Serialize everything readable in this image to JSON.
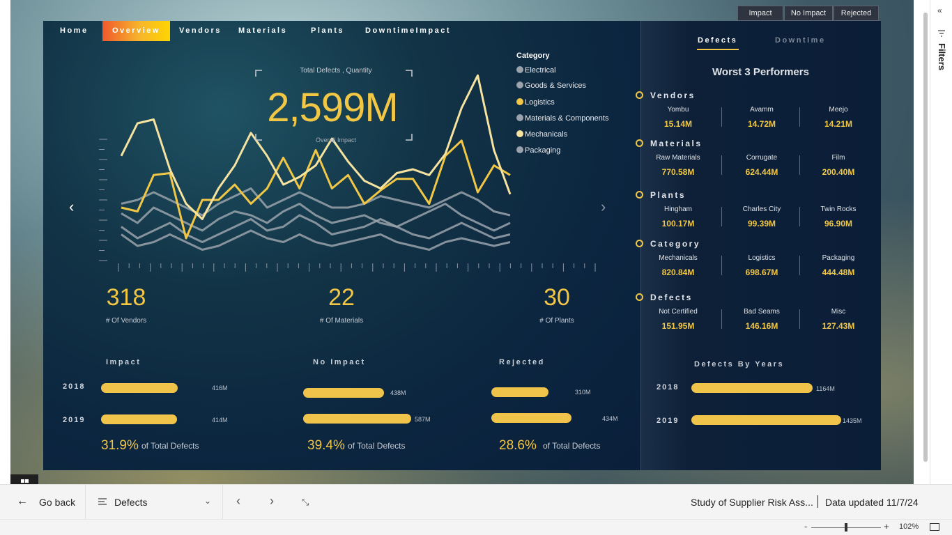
{
  "filter_chips": [
    "Impact",
    "No Impact",
    "Rejected"
  ],
  "nav": {
    "items": [
      "Home",
      "Overview",
      "Vendors",
      "Materials",
      "Plants",
      "DowntimeImpact"
    ],
    "active": "Overview"
  },
  "headline": {
    "caption": "Total Defects , Quantity",
    "value": "2,599M",
    "sub": "Overall Impact"
  },
  "legend": {
    "title": "Category",
    "items": [
      {
        "label": "Electrical",
        "color": "#9aa3ab"
      },
      {
        "label": "Goods & Services",
        "color": "#9aa3ab"
      },
      {
        "label": "Logistics",
        "color": "#f1c745"
      },
      {
        "label": "Materials & Components",
        "color": "#9aa3ab"
      },
      {
        "label": "Mechanicals",
        "color": "#f6e3a0"
      },
      {
        "label": "Packaging",
        "color": "#9aa3ab"
      }
    ]
  },
  "kpis": [
    {
      "value": "318",
      "label": "# Of Vendors"
    },
    {
      "value": "22",
      "label": "# Of Materials"
    },
    {
      "value": "30",
      "label": "# Of Plants"
    }
  ],
  "impact_sections": [
    {
      "title": "Impact",
      "bars": [
        {
          "year": "2018",
          "label": "416M",
          "value": 416
        },
        {
          "year": "2019",
          "label": "414M",
          "value": 414
        }
      ],
      "pct": "31.9%",
      "pct_label": "of Total Defects"
    },
    {
      "title": "No Impact",
      "bars": [
        {
          "year": "2018",
          "label": "438M",
          "value": 438
        },
        {
          "year": "2019",
          "label": "587M",
          "value": 587
        }
      ],
      "pct": "39.4%",
      "pct_label": "of Total Defects"
    },
    {
      "title": "Rejected",
      "bars": [
        {
          "year": "2018",
          "label": "310M",
          "value": 310
        },
        {
          "year": "2019",
          "label": "434M",
          "value": 434
        }
      ],
      "pct": "28.6%",
      "pct_label": "of Total Defects"
    }
  ],
  "right_panel": {
    "tabs": [
      "Defects",
      "Downtime"
    ],
    "active_tab": "Defects",
    "title": "Worst 3 Performers",
    "groups": [
      {
        "heading": "Vendors",
        "items": [
          {
            "name": "Yombu",
            "value": "15.14M"
          },
          {
            "name": "Avamm",
            "value": "14.72M"
          },
          {
            "name": "Meejo",
            "value": "14.21M"
          }
        ]
      },
      {
        "heading": "Materials",
        "items": [
          {
            "name": "Raw Materials",
            "value": "770.58M"
          },
          {
            "name": "Corrugate",
            "value": "624.44M"
          },
          {
            "name": "Film",
            "value": "200.40M"
          }
        ]
      },
      {
        "heading": "Plants",
        "items": [
          {
            "name": "Hingham",
            "value": "100.17M"
          },
          {
            "name": "Charles City",
            "value": "99.39M"
          },
          {
            "name": "Twin Rocks",
            "value": "96.90M"
          }
        ]
      },
      {
        "heading": "Category",
        "items": [
          {
            "name": "Mechanicals",
            "value": "820.84M"
          },
          {
            "name": "Logistics",
            "value": "698.67M"
          },
          {
            "name": "Packaging",
            "value": "444.48M"
          }
        ]
      },
      {
        "heading": "Defects",
        "items": [
          {
            "name": "Not Certified",
            "value": "151.95M"
          },
          {
            "name": "Bad Seams",
            "value": "146.16M"
          },
          {
            "name": "Misc",
            "value": "127.43M"
          }
        ]
      }
    ],
    "years_title": "Defects By Years",
    "years": [
      {
        "year": "2018",
        "label": "1164M",
        "value": 1164
      },
      {
        "year": "2019",
        "label": "1435M",
        "value": 1435
      }
    ]
  },
  "trend_chart": {
    "series": [
      {
        "color": "#f6e3a0",
        "values": [
          55,
          72,
          74,
          48,
          30,
          22,
          38,
          50,
          67,
          55,
          40,
          44,
          50,
          64,
          52,
          42,
          38,
          46,
          48,
          45,
          56,
          80,
          97,
          58,
          35
        ]
      },
      {
        "color": "#f1c745",
        "values": [
          28,
          26,
          45,
          46,
          12,
          32,
          32,
          40,
          30,
          38,
          54,
          38,
          58,
          38,
          45,
          30,
          37,
          43,
          43,
          30,
          55,
          63,
          36,
          50,
          45
        ]
      },
      {
        "color": "#9aa3ab",
        "values": [
          30,
          32,
          36,
          32,
          28,
          24,
          30,
          34,
          38,
          28,
          32,
          36,
          32,
          28,
          28,
          30,
          34,
          32,
          30,
          28,
          32,
          36,
          32,
          26,
          24
        ]
      },
      {
        "color": "#9aa3ab",
        "values": [
          25,
          20,
          28,
          24,
          20,
          16,
          22,
          26,
          24,
          20,
          26,
          30,
          24,
          20,
          22,
          24,
          20,
          18,
          22,
          26,
          30,
          24,
          20,
          16,
          20
        ]
      },
      {
        "color": "#9aa3ab",
        "values": [
          18,
          12,
          16,
          20,
          14,
          10,
          14,
          18,
          22,
          16,
          18,
          24,
          20,
          14,
          16,
          18,
          22,
          18,
          14,
          12,
          16,
          20,
          16,
          12,
          14
        ]
      },
      {
        "color": "#9aa3ab",
        "values": [
          14,
          8,
          10,
          14,
          10,
          6,
          8,
          12,
          16,
          12,
          10,
          14,
          10,
          8,
          10,
          12,
          14,
          10,
          8,
          6,
          10,
          12,
          10,
          8,
          10
        ]
      }
    ]
  },
  "bottom_bar": {
    "back_label": "Go back",
    "page_label": "Defects",
    "report_title": "Study of Supplier Risk Ass...",
    "data_updated": "Data updated 11/7/24"
  },
  "status_bar": {
    "zoom": "102%"
  },
  "filters_label": "Filters"
}
